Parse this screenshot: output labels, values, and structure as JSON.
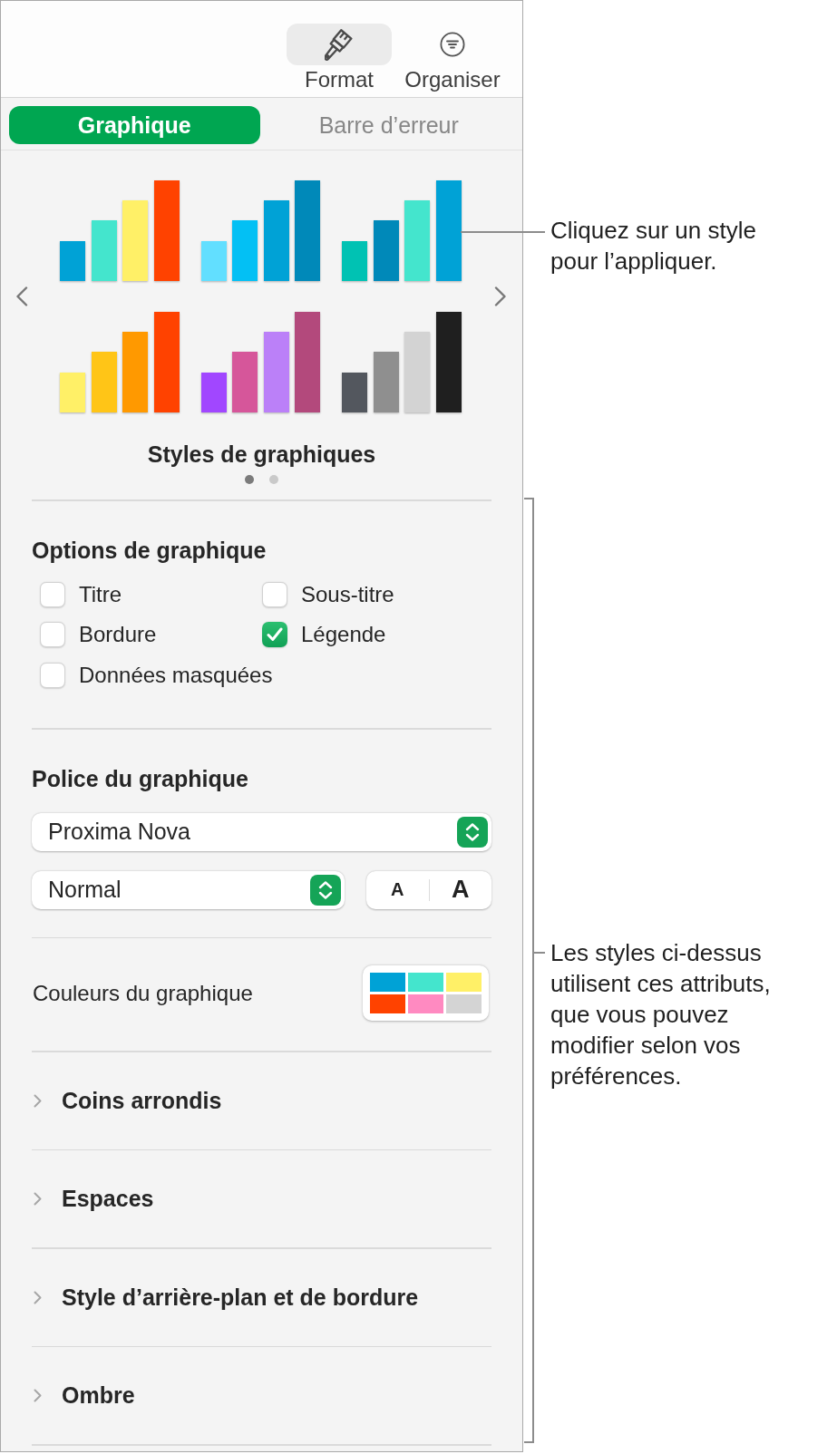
{
  "toolbar": {
    "buttons": [
      {
        "label": "Format",
        "kind": "format",
        "selected": true
      },
      {
        "label": "Organiser",
        "kind": "arrange",
        "selected": false
      }
    ]
  },
  "tabs": [
    {
      "label": "Graphique",
      "selected": true
    },
    {
      "label": "Barre d’erreur",
      "selected": false
    }
  ],
  "chart_styles": {
    "title": "Styles de graphiques",
    "styles": [
      {
        "bars": [
          {
            "color": "#00a2d6"
          },
          {
            "color": "#44e5cd"
          },
          {
            "color": "#fff067"
          },
          {
            "color": "#ff4200"
          }
        ]
      },
      {
        "bars": [
          {
            "color": "#62dfff"
          },
          {
            "color": "#03c0f4"
          },
          {
            "color": "#00a2d6"
          },
          {
            "color": "#0089b9"
          }
        ]
      },
      {
        "bars": [
          {
            "color": "#00c2b3"
          },
          {
            "color": "#0089b9"
          },
          {
            "color": "#44e5cd"
          },
          {
            "color": "#00a2d6"
          }
        ]
      },
      {
        "bars": [
          {
            "color": "#fff067"
          },
          {
            "color": "#ffc517"
          },
          {
            "color": "#ff9900"
          },
          {
            "color": "#ff4200"
          }
        ]
      },
      {
        "bars": [
          {
            "color": "#a147ff"
          },
          {
            "color": "#d6569a"
          },
          {
            "color": "#bb80f8"
          },
          {
            "color": "#b3497c"
          }
        ]
      },
      {
        "bars": [
          {
            "color": "#53575e"
          },
          {
            "color": "#8f8f8f"
          },
          {
            "color": "#d3d3d3"
          },
          {
            "color": "#1f1f1f"
          }
        ]
      }
    ],
    "pages": [
      {
        "selected": true
      },
      {
        "selected": false
      }
    ]
  },
  "chart_options": {
    "title": "Options de graphique",
    "options": [
      {
        "label": "Titre",
        "checked": false
      },
      {
        "label": "Sous-titre",
        "checked": false
      },
      {
        "label": "Bordure",
        "checked": false
      },
      {
        "label": "Légende",
        "checked": true
      },
      {
        "label": "Données masquées",
        "checked": false
      }
    ]
  },
  "chart_font": {
    "title": "Police du graphique",
    "family": "Proxima Nova",
    "typeface": "Normal",
    "size_buttons": [
      {
        "label": "A",
        "kind": "smaller"
      },
      {
        "label": "A",
        "kind": "larger"
      }
    ]
  },
  "chart_colors": {
    "label": "Couleurs du graphique",
    "swatches": [
      {
        "color": "#00a2d6"
      },
      {
        "color": "#44e5cd"
      },
      {
        "color": "#fff067"
      },
      {
        "color": "#ff4200"
      },
      {
        "color": "#ff8ac1"
      },
      {
        "color": "#d4d4d4"
      }
    ]
  },
  "sections": [
    {
      "label": "Coins arrondis",
      "expanded": false
    },
    {
      "label": "Espaces",
      "expanded": false
    },
    {
      "label": "Style d’arrière-plan et de bordure",
      "expanded": false
    },
    {
      "label": "Ombre",
      "expanded": false
    }
  ],
  "callouts": [
    {
      "kind": "leader",
      "text": "Cliquez sur un style pour l’appliquer."
    },
    {
      "kind": "bracket",
      "text": "Les styles ci-dessus utilisent ces attributs, que vous pouvez modifier selon vos préférences."
    }
  ]
}
